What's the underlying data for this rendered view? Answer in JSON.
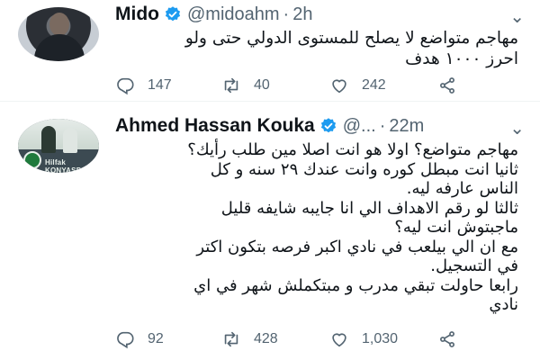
{
  "tweets": [
    {
      "name": "Mido",
      "handle": "@midoahm",
      "separator": "·",
      "time": "2h",
      "more": "⌄",
      "text_lines": [
        "مهاجم متواضع لا يصلح للمستوى الدولي حتى ولو",
        "احرز ١٠٠٠ هدف"
      ],
      "counts": {
        "replies": "147",
        "retweets": "40",
        "likes": "242"
      }
    },
    {
      "name": "Ahmed Hassan Kouka",
      "handle": "@...",
      "separator": "·",
      "time": "22m",
      "more": "⌄",
      "avatar_text": "Hilfak KONYASPOR",
      "text_lines": [
        "مهاجم متواضع؟ اولا هو انت اصلا مين طلب رأيك؟",
        "ثانيا انت مبطل كوره وانت عندك ٢٩ سنه و كل",
        "الناس عارفه ليه.",
        "ثالثا لو رقم الاهداف الي انا جايبه شايفه قليل",
        "ماجبتوش انت ليه؟",
        "مع ان الي بيلعب في نادي اكبر فرصه بتكون اكتر",
        "في التسجيل.",
        "رابعا حاولت تبقي مدرب و مبتكملش شهر في اي",
        "نادي"
      ],
      "counts": {
        "replies": "92",
        "retweets": "428",
        "likes": "1,030"
      }
    }
  ],
  "colors": {
    "text": "#0f1419",
    "secondary": "#536471",
    "verified": "#1d9bf0"
  },
  "icons": [
    "reply-icon",
    "retweet-icon",
    "like-icon",
    "share-icon",
    "verified-badge-icon"
  ]
}
